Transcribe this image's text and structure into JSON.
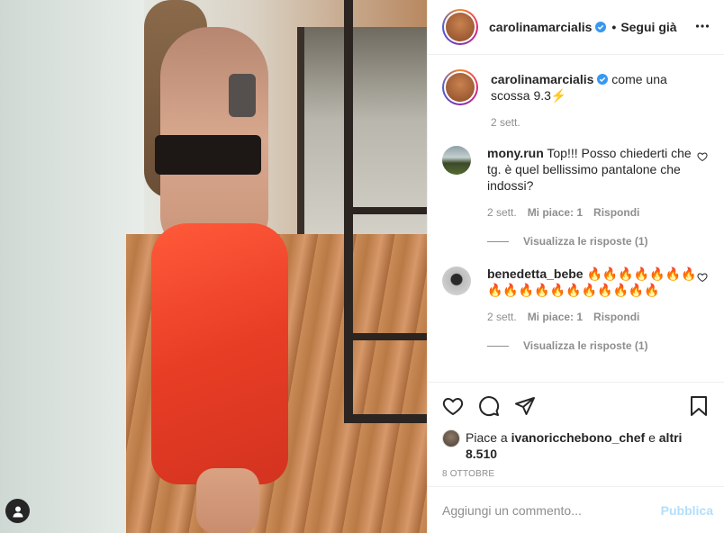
{
  "post": {
    "author": "carolinamarcialis",
    "follow_dot": "•",
    "follow_label": "Segui già",
    "more_icon": "more-horizontal-icon",
    "verified_color": "#3897f0"
  },
  "caption": {
    "username": "carolinamarcialis",
    "text": "come una scossa 9.3⚡️",
    "time": "2 sett."
  },
  "comments": [
    {
      "username": "mony.run",
      "text": "Top!!! Posso chiederti che tg. è quel bellissimo pantalone che indossi?",
      "time": "2 sett.",
      "likes": "Mi piace: 1",
      "reply": "Rispondi",
      "view_replies": "Visualizza le risposte (1)"
    },
    {
      "username": "benedetta_bebe",
      "text": "🔥🔥🔥🔥🔥🔥🔥🔥🔥🔥🔥🔥🔥🔥🔥🔥🔥🔥",
      "time": "2 sett.",
      "likes": "Mi piace: 1",
      "reply": "Rispondi",
      "view_replies": "Visualizza le risposte (1)"
    }
  ],
  "likes": {
    "prefix": "Piace a",
    "user": "ivanoricchebono_chef",
    "joiner": "e",
    "others": "altri 8.510"
  },
  "date": "8 OTTOBRE",
  "add_comment": {
    "placeholder": "Aggiungi un commento...",
    "publish": "Pubblica"
  },
  "colors": {
    "text": "#262626",
    "muted": "#8e8e8e",
    "publish_disabled": "#b2dffc",
    "border": "#efefef"
  }
}
